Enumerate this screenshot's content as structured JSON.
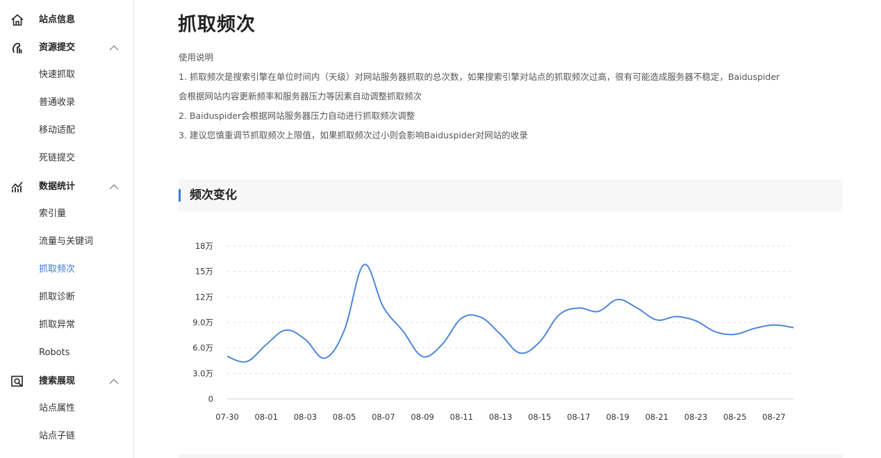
{
  "sidebar": {
    "groups": [
      {
        "label": "站点信息",
        "icon": "home-icon",
        "expandable": false,
        "items": []
      },
      {
        "label": "资源提交",
        "icon": "resource-submit-icon",
        "expandable": true,
        "items": [
          "快速抓取",
          "普通收录",
          "移动适配",
          "死链提交"
        ]
      },
      {
        "label": "数据统计",
        "icon": "stats-icon",
        "expandable": true,
        "items": [
          "索引量",
          "流量与关键词",
          "抓取频次",
          "抓取诊断",
          "抓取异常",
          "Robots"
        ]
      },
      {
        "label": "搜索展现",
        "icon": "search-display-icon",
        "expandable": true,
        "items": [
          "站点属性",
          "站点子链"
        ]
      }
    ],
    "active_item": "抓取频次"
  },
  "main": {
    "title": "抓取频次",
    "usage": {
      "heading": "使用说明",
      "line1a": "1. 抓取频次是搜索引擎在单位时间内（天级）对网站服务器抓取的总次数，如果搜索引擎对站点的抓取频次过高，很有可能造成服务器不稳定，Baiduspider",
      "line1b": "会根据网站内容更新频率和服务器压力等因素自动调整抓取频次",
      "line2": "2. Baiduspider会根据网站服务器压力自动进行抓取频次调整",
      "line3": "3. 建议您慎重调节抓取频次上限值，如果抓取频次过小则会影响Baiduspider对网站的收录"
    },
    "section_title": "频次变化"
  },
  "chart_data": {
    "type": "line",
    "x": [
      "07-30",
      "07-31",
      "08-01",
      "08-02",
      "08-03",
      "08-04",
      "08-05",
      "08-06",
      "08-07",
      "08-08",
      "08-09",
      "08-10",
      "08-11",
      "08-12",
      "08-13",
      "08-14",
      "08-15",
      "08-16",
      "08-17",
      "08-18",
      "08-19",
      "08-20",
      "08-21",
      "08-22",
      "08-23",
      "08-24",
      "08-25",
      "08-26",
      "08-27",
      "08-28"
    ],
    "x_tick_labels": [
      "07-30",
      "08-01",
      "08-03",
      "08-05",
      "08-07",
      "08-09",
      "08-11",
      "08-13",
      "08-15",
      "08-17",
      "08-19",
      "08-21",
      "08-23",
      "08-25",
      "08-27"
    ],
    "series": [
      {
        "values": [
          50000,
          44000,
          64000,
          81000,
          70000,
          48000,
          81000,
          158000,
          108000,
          80000,
          50000,
          64000,
          95000,
          96000,
          76000,
          54000,
          67000,
          99000,
          107000,
          103000,
          117000,
          107000,
          93000,
          97000,
          92000,
          79000,
          76000,
          83000,
          87000,
          84000
        ],
        "color": "#4a86dc"
      }
    ],
    "y_ticks": [
      0,
      30000,
      60000,
      90000,
      120000,
      150000,
      180000
    ],
    "y_tick_labels": [
      "0",
      "3.0万",
      "6.0万",
      "9.0万",
      "12万",
      "15万",
      "18万"
    ],
    "ylim": [
      0,
      180000
    ],
    "grid": true,
    "legend": "none"
  }
}
